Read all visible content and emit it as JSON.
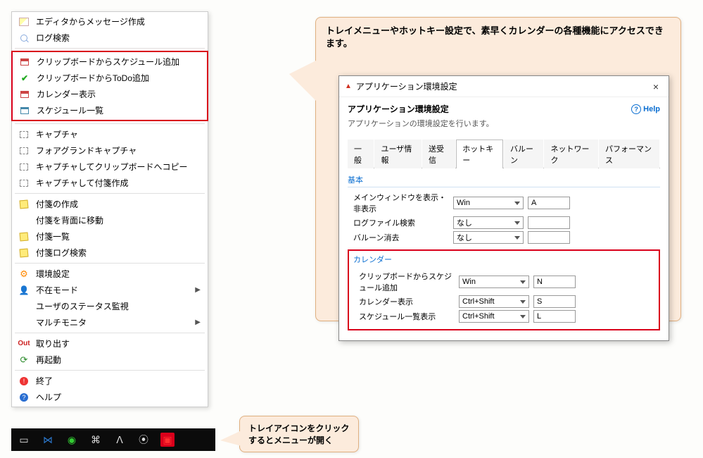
{
  "callouts": {
    "top": "トレイメニューやホットキー設定で、素早くカレンダーの各種機能にアクセスできます。",
    "bottom": "トレイアイコンをクリックするとメニューが開く"
  },
  "menu": {
    "group_a": [
      {
        "icon": "edit",
        "label": "エディタからメッセージ作成"
      },
      {
        "icon": "search",
        "label": "ログ検索"
      }
    ],
    "group_highlight": [
      {
        "icon": "cal",
        "label": "クリップボードからスケジュール追加"
      },
      {
        "icon": "check",
        "label": "クリップボードからToDo追加"
      },
      {
        "icon": "cal",
        "label": "カレンダー表示"
      },
      {
        "icon": "list",
        "label": "スケジュール一覧"
      }
    ],
    "group_capture": [
      {
        "icon": "cap",
        "label": "キャプチャ"
      },
      {
        "icon": "cap",
        "label": "フォアグランドキャプチャ"
      },
      {
        "icon": "cap",
        "label": "キャプチャしてクリップボードへコピー"
      },
      {
        "icon": "cap",
        "label": "キャプチャして付箋作成"
      }
    ],
    "group_fusen": [
      {
        "icon": "note",
        "label": "付箋の作成"
      },
      {
        "icon": "",
        "label": "付箋を背面に移動"
      },
      {
        "icon": "note",
        "label": "付箋一覧"
      },
      {
        "icon": "note",
        "label": "付箋ログ検索"
      }
    ],
    "group_settings": [
      {
        "icon": "gear",
        "label": "環境設定"
      },
      {
        "icon": "user",
        "label": "不在モード",
        "arrow": true
      },
      {
        "icon": "",
        "label": "ユーザのステータス監視"
      },
      {
        "icon": "",
        "label": "マルチモニタ",
        "arrow": true
      }
    ],
    "group_power": [
      {
        "icon": "out",
        "label": "取り出す"
      },
      {
        "icon": "reload",
        "label": "再起動"
      }
    ],
    "group_exit": [
      {
        "icon": "stop",
        "label": "終了"
      },
      {
        "icon": "help",
        "label": "ヘルプ"
      }
    ]
  },
  "dialog": {
    "titlebar": "アプリケーション環境設定",
    "close": "×",
    "heading": "アプリケーション環境設定",
    "help": "Help",
    "sub": "アプリケーションの環境設定を行います。",
    "tabs": [
      "一般",
      "ユーザ情報",
      "送受信",
      "ホットキー",
      "バルーン",
      "ネットワーク",
      "パフォーマンス"
    ],
    "active_tab": 3,
    "section_basic": {
      "title": "基本",
      "rows": [
        {
          "label": "メインウィンドウを表示・非表示",
          "mod": "Win",
          "key": "A"
        },
        {
          "label": "ログファイル検索",
          "mod": "なし",
          "key": ""
        },
        {
          "label": "バルーン消去",
          "mod": "なし",
          "key": ""
        }
      ]
    },
    "section_calendar": {
      "title": "カレンダー",
      "rows": [
        {
          "label": "クリップボードからスケジュール追加",
          "mod": "Win",
          "key": "N"
        },
        {
          "label": "カレンダー表示",
          "mod": "Ctrl+Shift",
          "key": "S"
        },
        {
          "label": "スケジュール一覧表示",
          "mod": "Ctrl+Shift",
          "key": "L"
        }
      ]
    }
  }
}
